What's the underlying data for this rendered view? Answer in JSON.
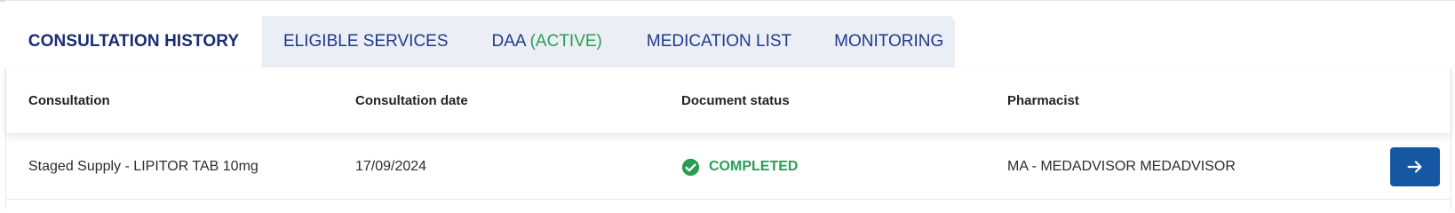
{
  "tabs": {
    "active": "CONSULTATION HISTORY",
    "eligible": "ELIGIBLE SERVICES",
    "daa_label": "DAA",
    "daa_status": "(ACTIVE)",
    "medication": "MEDICATION LIST",
    "monitoring": "MONITORING"
  },
  "table": {
    "headers": [
      "Consultation",
      "Consultation date",
      "Document status",
      "Pharmacist"
    ],
    "rows": [
      {
        "consultation": "Staged Supply - LIPITOR TAB 10mg",
        "date": "17/09/2024",
        "status": "COMPLETED",
        "status_icon": "check-circle-icon",
        "pharmacist": "MA - MEDADVISOR MEDADVISOR",
        "action_icon": "arrow-right-icon"
      }
    ]
  },
  "colors": {
    "primary": "#1a2c73",
    "tab_text": "#1f3a8a",
    "success": "#2a9d55",
    "action_button": "#1557a3",
    "tab_group_bg": "#eceef6"
  }
}
